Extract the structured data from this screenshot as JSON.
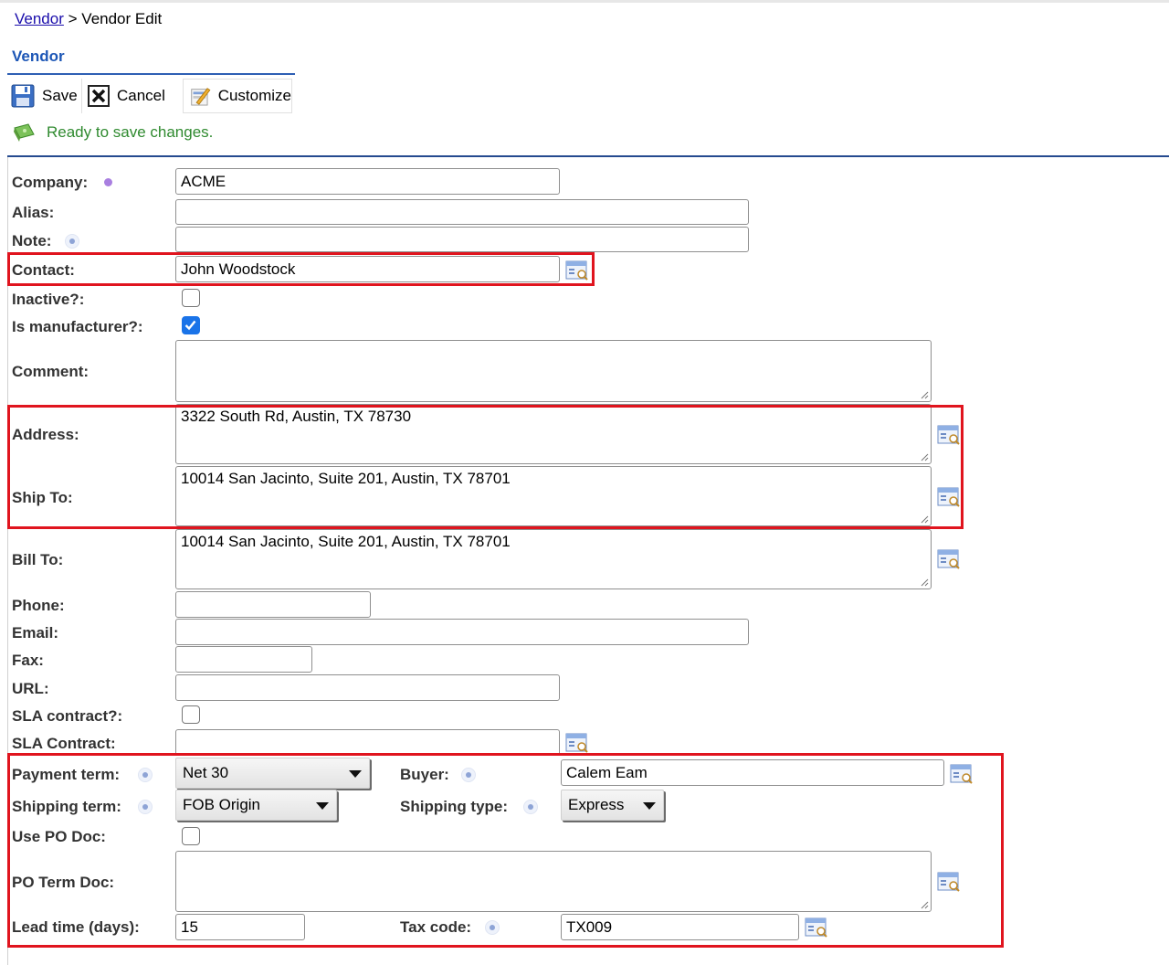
{
  "breadcrumb": {
    "parent": "Vendor",
    "separator": ">",
    "current": "Vendor Edit"
  },
  "section_title": "Vendor",
  "toolbar": {
    "save": "Save",
    "cancel": "Cancel",
    "customize": "Customize"
  },
  "status": {
    "text": "Ready to save changes."
  },
  "form": {
    "company": {
      "label": "Company:",
      "value": "ACME"
    },
    "alias": {
      "label": "Alias:",
      "value": ""
    },
    "note": {
      "label": "Note:",
      "value": ""
    },
    "contact": {
      "label": "Contact:",
      "value": "John Woodstock"
    },
    "inactive": {
      "label": "Inactive?:",
      "checked": false
    },
    "is_manufacturer": {
      "label": "Is manufacturer?:",
      "checked": true
    },
    "comment": {
      "label": "Comment:",
      "value": ""
    },
    "address": {
      "label": "Address:",
      "value": "3322 South Rd, Austin, TX 78730"
    },
    "ship_to": {
      "label": "Ship To:",
      "value": "10014 San Jacinto, Suite 201, Austin, TX 78701"
    },
    "bill_to": {
      "label": "Bill To:",
      "value": "10014 San Jacinto, Suite 201, Austin, TX 78701"
    },
    "phone": {
      "label": "Phone:",
      "value": ""
    },
    "email": {
      "label": "Email:",
      "value": ""
    },
    "fax": {
      "label": "Fax:",
      "value": ""
    },
    "url": {
      "label": "URL:",
      "value": ""
    },
    "sla_contract_flag": {
      "label": "SLA contract?:",
      "checked": false
    },
    "sla_contract": {
      "label": "SLA Contract:",
      "value": ""
    },
    "payment_term": {
      "label": "Payment term:",
      "value": "Net 30"
    },
    "buyer": {
      "label": "Buyer:",
      "value": "Calem Eam"
    },
    "shipping_term": {
      "label": "Shipping term:",
      "value": "FOB Origin"
    },
    "shipping_type": {
      "label": "Shipping type:",
      "value": "Express"
    },
    "use_po_doc": {
      "label": "Use PO Doc:",
      "checked": false
    },
    "po_term_doc": {
      "label": "PO Term Doc:",
      "value": ""
    },
    "lead_time": {
      "label": "Lead time (days):",
      "value": "15"
    },
    "tax_code": {
      "label": "Tax code:",
      "value": "TX009"
    }
  },
  "colors": {
    "highlight": "#e0141e",
    "title_blue": "#1c56b6",
    "status_green": "#2f8a2f",
    "checkbox_blue": "#1a73e8"
  }
}
